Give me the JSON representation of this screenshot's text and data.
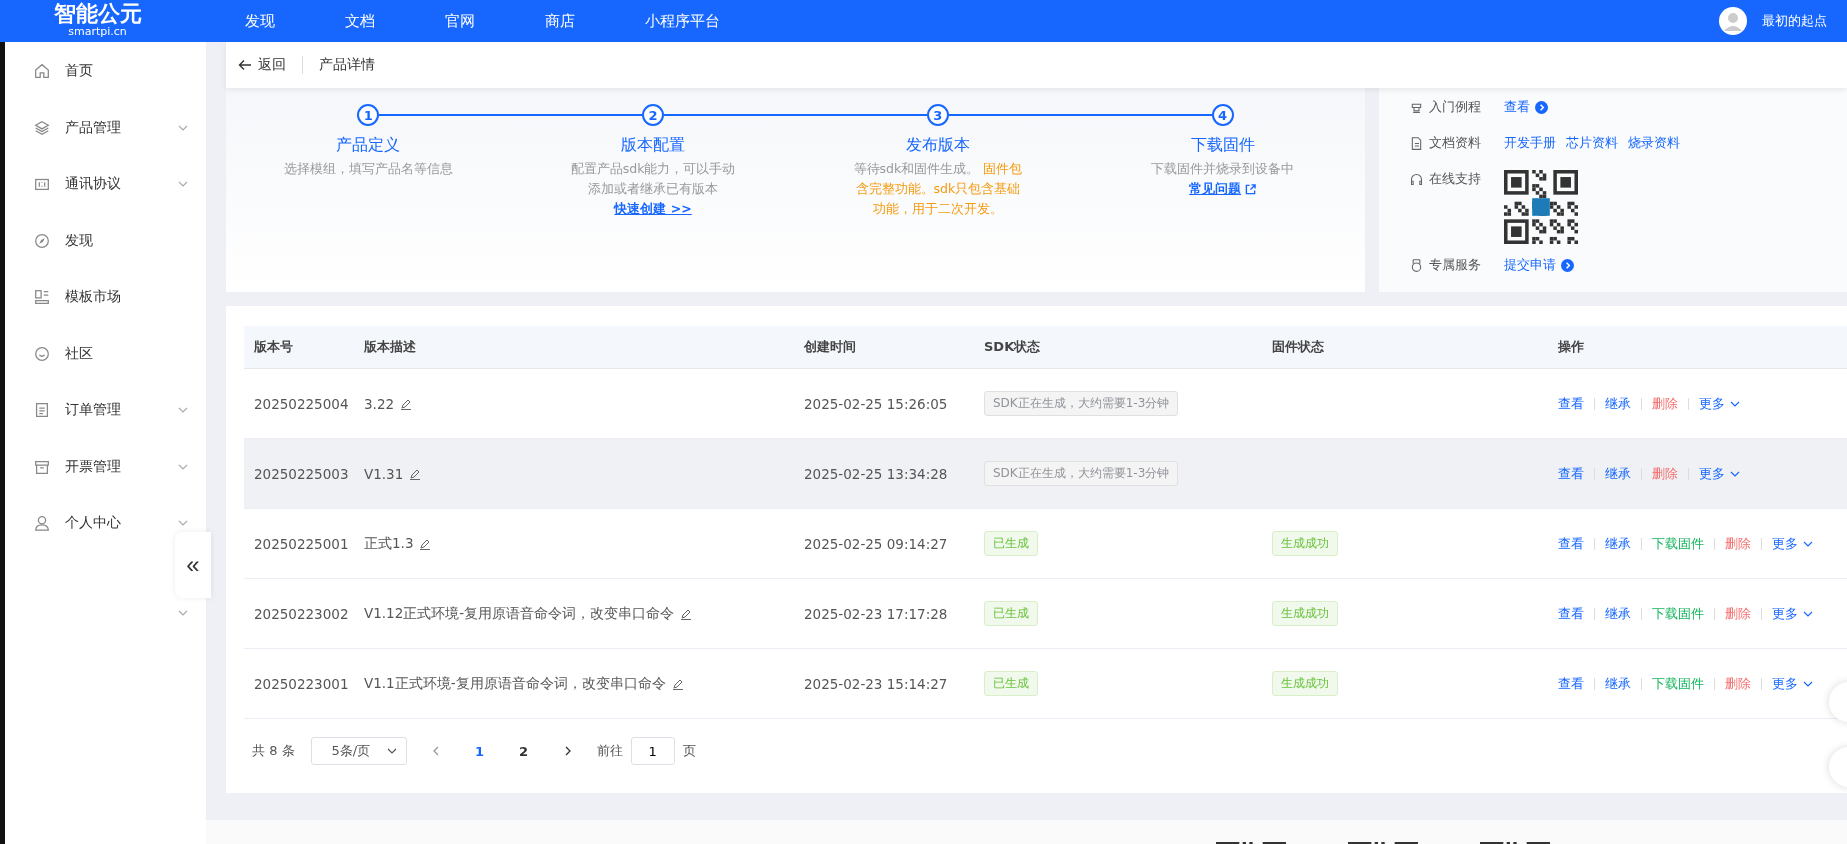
{
  "top_nav": {
    "logo": "智能公元",
    "domain": "smartpi.cn",
    "items": [
      "发现",
      "文档",
      "官网",
      "商店",
      "小程序平台"
    ],
    "user": "最初的起点"
  },
  "sidebar": {
    "items": [
      {
        "label": "首页",
        "expandable": false
      },
      {
        "label": "产品管理",
        "expandable": true
      },
      {
        "label": "通讯协议",
        "expandable": true
      },
      {
        "label": "发现",
        "expandable": false
      },
      {
        "label": "模板市场",
        "expandable": false
      },
      {
        "label": "社区",
        "expandable": false
      },
      {
        "label": "订单管理",
        "expandable": true
      },
      {
        "label": "开票管理",
        "expandable": true
      },
      {
        "label": "个人中心",
        "expandable": true
      }
    ],
    "collapse_button": "«"
  },
  "page_header": {
    "back": "返回",
    "title": "产品详情"
  },
  "steps": [
    {
      "number": "1",
      "title": "产品定义",
      "description": [
        {
          "text": "选择模组，填写产品名等信息",
          "warning": false
        }
      ]
    },
    {
      "number": "2",
      "title": "版本配置",
      "description": [
        {
          "text": "配置产品sdk能力，可以手动添加或者继承已有版本",
          "warning": false
        }
      ],
      "link": {
        "text": "快速创建 >>",
        "external": false
      }
    },
    {
      "number": "3",
      "title": "发布版本",
      "description": [
        {
          "text": "等待sdk和固件生成。 ",
          "warning": false
        },
        {
          "text": "固件包含完整功能。sdk只包含基础功能，用于二次开发。",
          "warning": true
        }
      ]
    },
    {
      "number": "4",
      "title": "下载固件",
      "description": [
        {
          "text": "下载固件并烧录到设备中",
          "warning": false
        }
      ],
      "link": {
        "text": "常见问题",
        "external": true
      }
    }
  ],
  "resources": [
    {
      "label": "入门例程",
      "kind": "links",
      "links": [
        {
          "text": "查看",
          "arrow": true
        }
      ]
    },
    {
      "label": "文档资料",
      "kind": "links",
      "links": [
        {
          "text": "开发手册",
          "arrow": false
        },
        {
          "text": "芯片资料",
          "arrow": false
        },
        {
          "text": "烧录资料",
          "arrow": false
        }
      ]
    },
    {
      "label": "在线支持",
      "kind": "qr"
    },
    {
      "label": "专属服务",
      "kind": "links",
      "links": [
        {
          "text": "提交申请",
          "arrow": true
        }
      ]
    }
  ],
  "table": {
    "columns": [
      "版本号",
      "版本描述",
      "创建时间",
      "SDK状态",
      "固件状态",
      "操作"
    ],
    "rows": [
      {
        "version": "20250225004",
        "description": "3.22",
        "created": "2025-02-25 15:26:05",
        "sdk_status": {
          "text": "SDK正在生成，大约需要1-3分钟",
          "kind": "pending"
        },
        "hovered": false,
        "actions": [
          {
            "label": "查看",
            "kind": "view"
          },
          {
            "label": "继承",
            "kind": "inherit"
          },
          {
            "label": "删除",
            "kind": "delete"
          },
          {
            "label": "更多",
            "kind": "more"
          }
        ]
      },
      {
        "version": "20250225003",
        "description": "V1.31",
        "created": "2025-02-25 13:34:28",
        "sdk_status": {
          "text": "SDK正在生成，大约需要1-3分钟",
          "kind": "pending"
        },
        "hovered": true,
        "actions": [
          {
            "label": "查看",
            "kind": "view"
          },
          {
            "label": "继承",
            "kind": "inherit"
          },
          {
            "label": "删除",
            "kind": "delete"
          },
          {
            "label": "更多",
            "kind": "more"
          }
        ]
      },
      {
        "version": "20250225001",
        "description": "正式1.3",
        "created": "2025-02-25 09:14:27",
        "sdk_status": {
          "text": "已生成",
          "kind": "done"
        },
        "firmware_status": {
          "text": "生成成功",
          "kind": "done"
        },
        "hovered": false,
        "actions": [
          {
            "label": "查看",
            "kind": "view"
          },
          {
            "label": "继承",
            "kind": "inherit"
          },
          {
            "label": "下载固件",
            "kind": "download"
          },
          {
            "label": "删除",
            "kind": "delete"
          },
          {
            "label": "更多",
            "kind": "more"
          }
        ]
      },
      {
        "version": "20250223002",
        "description": "V1.12正式环境-复用原语音命令词，改变串口命令",
        "created": "2025-02-23 17:17:28",
        "sdk_status": {
          "text": "已生成",
          "kind": "done"
        },
        "firmware_status": {
          "text": "生成成功",
          "kind": "done"
        },
        "hovered": false,
        "actions": [
          {
            "label": "查看",
            "kind": "view"
          },
          {
            "label": "继承",
            "kind": "inherit"
          },
          {
            "label": "下载固件",
            "kind": "download"
          },
          {
            "label": "删除",
            "kind": "delete"
          },
          {
            "label": "更多",
            "kind": "more"
          }
        ]
      },
      {
        "version": "20250223001",
        "description": "V1.1正式环境-复用原语音命令词，改变串口命令",
        "created": "2025-02-23 15:14:27",
        "sdk_status": {
          "text": "已生成",
          "kind": "done"
        },
        "firmware_status": {
          "text": "生成成功",
          "kind": "done"
        },
        "hovered": false,
        "actions": [
          {
            "label": "查看",
            "kind": "view"
          },
          {
            "label": "继承",
            "kind": "inherit"
          },
          {
            "label": "下载固件",
            "kind": "download"
          },
          {
            "label": "删除",
            "kind": "delete"
          },
          {
            "label": "更多",
            "kind": "more"
          }
        ]
      }
    ]
  },
  "pagination": {
    "total": "共 8 条",
    "page_size": "5条/页",
    "pages": [
      {
        "label": "1",
        "selected": true
      },
      {
        "label": "2",
        "selected": false
      }
    ],
    "goto_label": "前往",
    "goto_value": "1",
    "goto_suffix": "页"
  }
}
